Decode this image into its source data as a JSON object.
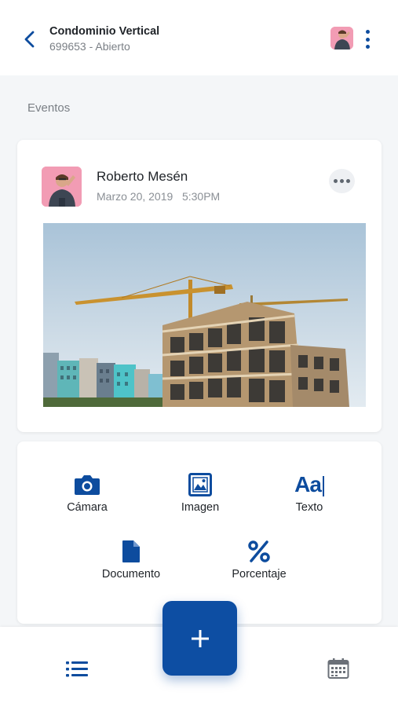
{
  "header": {
    "title": "Condominio Vertical",
    "subtitle": "699653 - Abierto",
    "back_icon": "chevron-left-icon",
    "menu_icon": "kebab-menu-icon"
  },
  "section": {
    "label": "Eventos"
  },
  "post": {
    "author": "Roberto Mesén",
    "date": "Marzo 20, 2019   5:30PM",
    "image_alt": "Building under construction with tower cranes"
  },
  "actions": [
    {
      "label": "Cámara",
      "icon": "camera-icon"
    },
    {
      "label": "Imagen",
      "icon": "image-icon"
    },
    {
      "label": "Texto",
      "icon": "text-icon"
    },
    {
      "label": "Documento",
      "icon": "document-icon"
    },
    {
      "label": "Porcentaje",
      "icon": "percent-icon"
    }
  ],
  "bottom_nav": {
    "list_icon": "list-icon",
    "fab_icon": "plus-icon",
    "calendar_icon": "calendar-icon"
  },
  "colors": {
    "primary": "#0d4ea3",
    "icon_blue": "#0d4c9e",
    "background": "#f4f6f8",
    "avatar_bg": "#f29cb4"
  }
}
